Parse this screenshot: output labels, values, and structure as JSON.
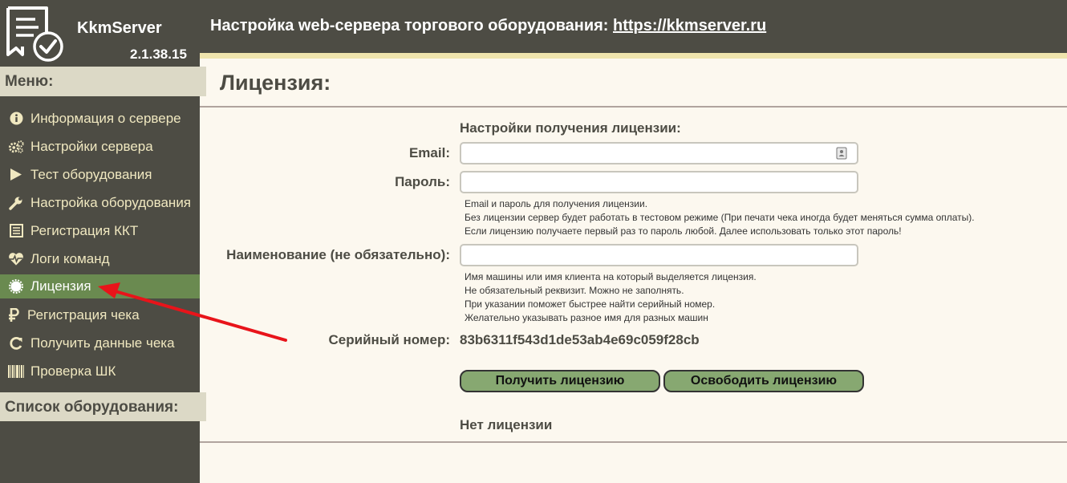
{
  "app": {
    "name": "KkmServer",
    "version": "2.1.38.15"
  },
  "header": {
    "title": "Настройка web-сервера торгового оборудования:",
    "link": "https://kkmserver.ru"
  },
  "sidebar": {
    "menu_label": "Меню:",
    "items": [
      {
        "label": "Информация о сервере",
        "icon": "info-icon"
      },
      {
        "label": "Настройки сервера",
        "icon": "gears-icon"
      },
      {
        "label": "Тест оборудования",
        "icon": "play-icon"
      },
      {
        "label": "Настройка оборудования",
        "icon": "wrench-icon"
      },
      {
        "label": "Регистрация ККТ",
        "icon": "register-icon"
      },
      {
        "label": "Логи команд",
        "icon": "heartbeat-icon"
      },
      {
        "label": "Лицензия",
        "icon": "certificate-icon",
        "active": true
      },
      {
        "label": "Регистрация чека",
        "icon": "ruble-icon"
      },
      {
        "label": "Получить данные чека",
        "icon": "refresh-icon"
      },
      {
        "label": "Проверка ШК",
        "icon": "barcode-icon"
      }
    ],
    "equipment_label": "Список оборудования:"
  },
  "main": {
    "title": "Лицензия:",
    "section_title": "Настройки получения лицензии:",
    "email": {
      "label": "Email:",
      "value": ""
    },
    "password": {
      "label": "Пароль:",
      "value": ""
    },
    "credentials_help": [
      "Email и пароль для получения лицензии.",
      "Без лицензии сервер будет работать в тестовом режиме (При печати чека иногда будет меняться сумма оплаты).",
      "Если лицензию получаете первый раз то пароль любой. Далее использовать только этот пароль!"
    ],
    "name": {
      "label": "Наименование (не обязательно):",
      "value": ""
    },
    "name_help": [
      "Имя машины или имя клиента на который выделяется лицензия.",
      "Не обязательный реквизит. Можно не заполнять.",
      "При указании поможет быстрее найти серийный номер.",
      "Желательно указывать разное имя для разных машин"
    ],
    "serial": {
      "label": "Серийный номер:",
      "value": "83b6311f543d1de53ab4e69c059f28cb"
    },
    "get_license_button": "Получить лицензию",
    "release_license_button": "Освободить лицензию",
    "status": "Нет лицензии"
  },
  "colors": {
    "sidebar_bg": "#4d4c44",
    "section_header_bg": "#dcd9c6",
    "active_item_bg": "#6a8a50",
    "button_bg": "#87a871",
    "accent_stripe": "#efe4ad",
    "annotation_arrow": "#e8141a"
  }
}
